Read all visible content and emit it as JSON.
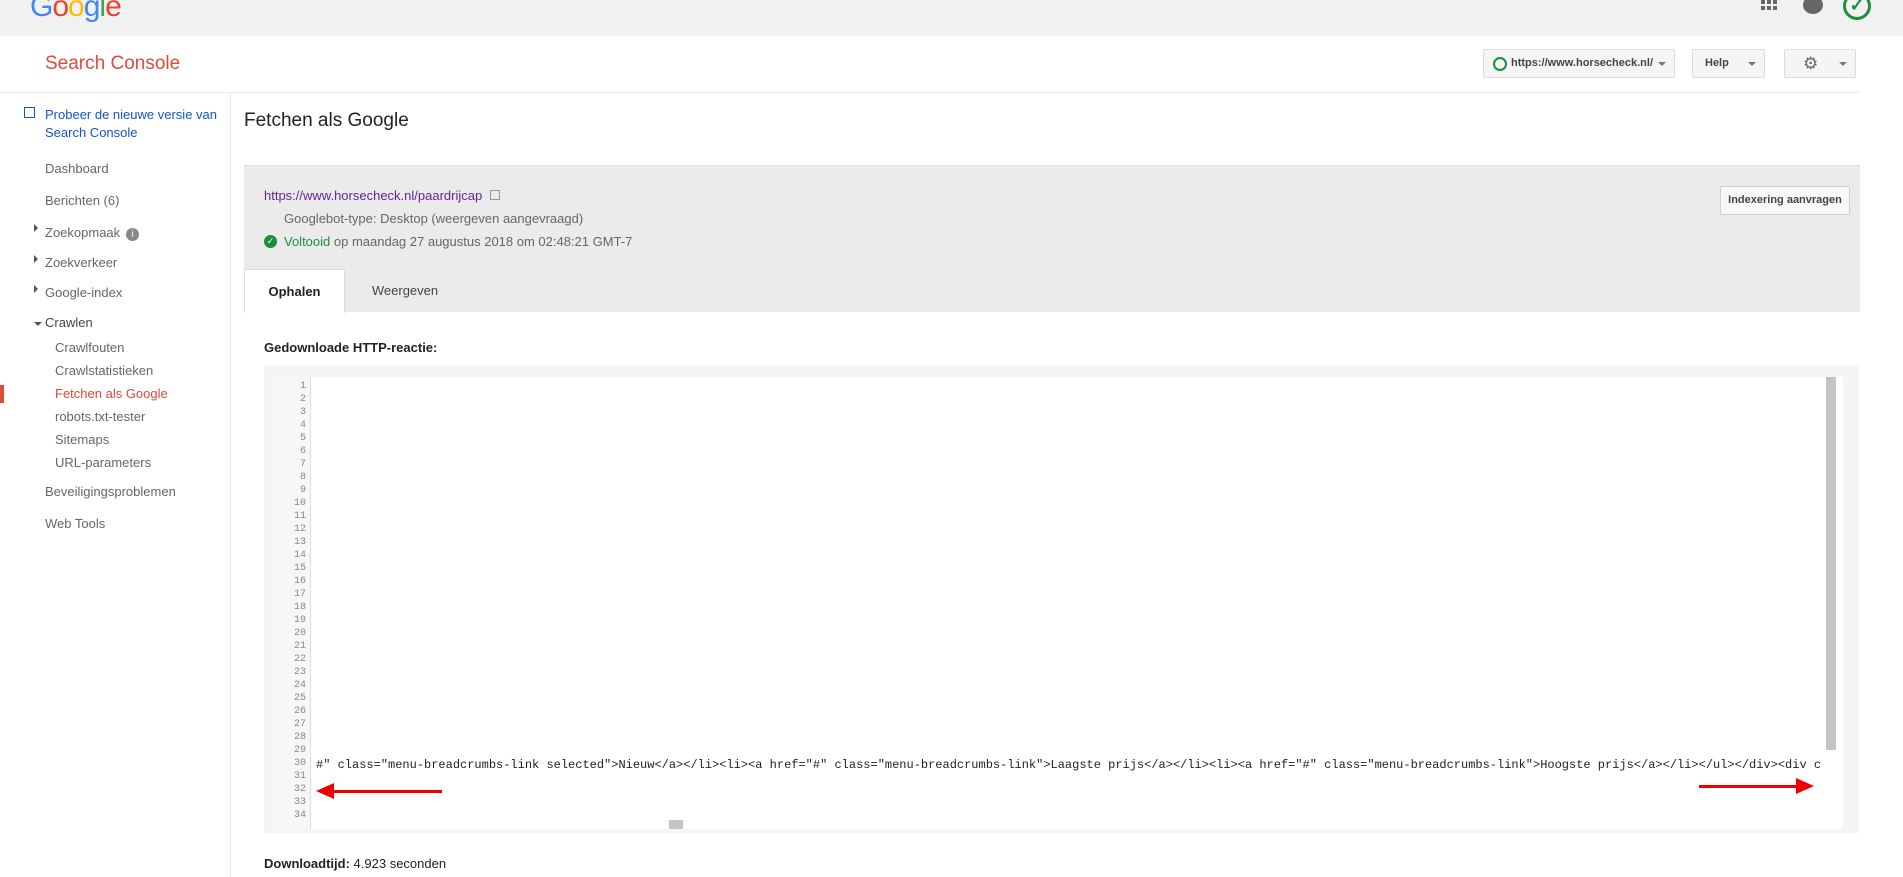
{
  "topbar": {
    "logo_letters": [
      "G",
      "o",
      "o",
      "g",
      "l",
      "e"
    ],
    "apps_icon": "apps-grid-icon",
    "account_icon": "account-icon",
    "status_icon": "check-circle-icon"
  },
  "header": {
    "title": "Search Console",
    "site": "https://www.horsecheck.nl/",
    "help_label": "Help",
    "settings_icon": "gear-icon"
  },
  "sidebar": {
    "new_version": "Probeer de nieuwe versie van Search Console",
    "items": {
      "dashboard": "Dashboard",
      "berichten": "Berichten (6)",
      "zoekopmaak": "Zoekopmaak",
      "zoekverkeer": "Zoekverkeer",
      "google_index": "Google-index",
      "crawlen": "Crawlen",
      "crawlfouten": "Crawlfouten",
      "crawlstatistieken": "Crawlstatistieken",
      "fetchen": "Fetchen als Google",
      "robots": "robots.txt-tester",
      "sitemaps": "Sitemaps",
      "url_parameters": "URL-parameters",
      "beveiliging": "Beveiligingsproblemen",
      "web_tools": "Web Tools"
    }
  },
  "main": {
    "page_title": "Fetchen als Google",
    "fetched_url": "https://www.horsecheck.nl/paardrijcap",
    "bot_type": "Googlebot-type: Desktop (weergeven aangevraagd)",
    "status_word": "Voltooid",
    "status_rest": " op maandag 27 augustus 2018 om 02:48:21 GMT-7",
    "index_button": "Indexering aanvragen",
    "tab_fetch": "Ophalen",
    "tab_render": "Weergeven",
    "response_label": "Gedownloade HTTP-reactie:",
    "line_numbers": "1\n2\n3\n4\n5\n6\n7\n8\n9\n10\n11\n12\n13\n14\n15\n16\n17\n18\n19\n20\n21\n22\n23\n24\n25\n26\n27\n28\n29\n30\n31\n32\n33\n34",
    "code_line_29": "#\" class=\"menu-breadcrumbs-link selected\">Nieuw</a></li><li><a href=\"#\" class=\"menu-breadcrumbs-link\">Laagste prijs</a></li><li><a href=\"#\" class=\"menu-breadcrumbs-link\">Hoogste prijs</a></li></ul></div><div class=",
    "download_label": "Downloadtijd:",
    "download_value": " 4.923 seconden"
  }
}
